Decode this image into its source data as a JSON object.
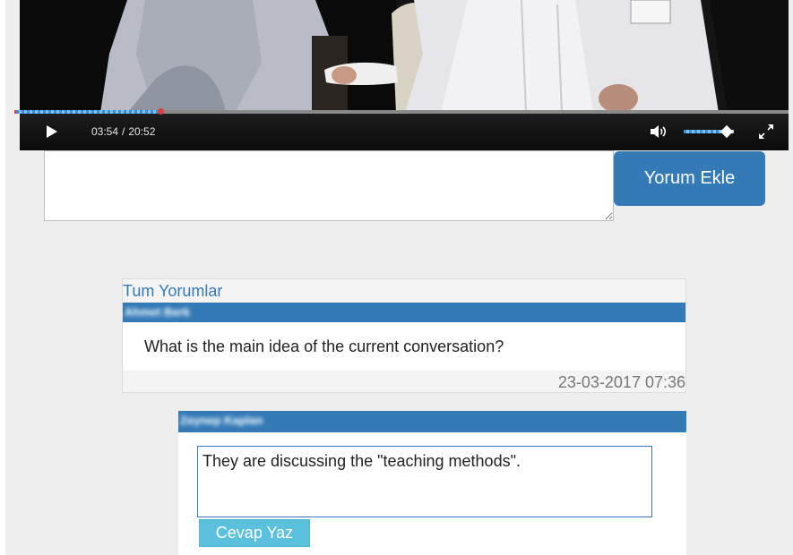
{
  "video": {
    "current_time": "03:54",
    "separator": "/",
    "duration": "20:52",
    "progress": 0.187,
    "volume": 0.85
  },
  "comment_form": {
    "comment_input_value": "",
    "add_button_label": "Yorum Ekle"
  },
  "comments": {
    "section_title": "Tum Yorumlar",
    "items": [
      {
        "author": "Ahmet Berk",
        "text": "What is the main idea of the current conversation?",
        "date": "23-03-2017 07:36"
      }
    ]
  },
  "reply": {
    "author": "Zeynep Kaplan",
    "input_value": "They are discussing the \"teaching methods\".",
    "button_label": "Cevap Yaz"
  },
  "colors": {
    "primary": "#337ab7",
    "reply_button": "#5bc0de",
    "page_background": "#eeeeee"
  },
  "icons": [
    "play-icon",
    "volume-icon",
    "fullscreen-icon"
  ]
}
